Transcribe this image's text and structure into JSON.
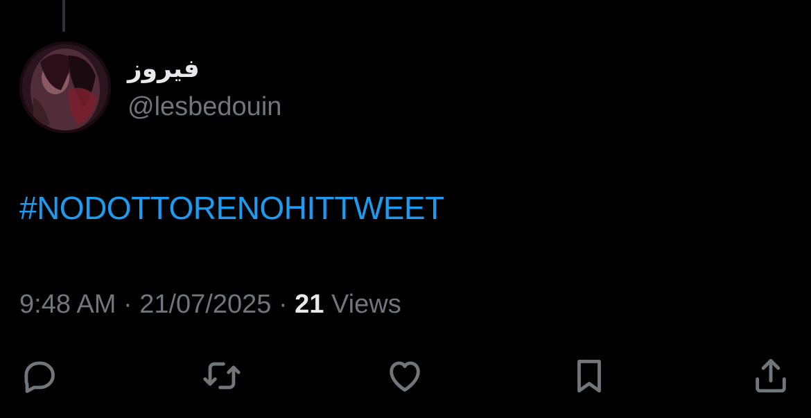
{
  "author": {
    "display_name": "فيروز",
    "handle": "@lesbedouin"
  },
  "tweet": {
    "text": "#NODOTTORENOHITTWEET"
  },
  "meta": {
    "time": "9:48 AM",
    "separator": " · ",
    "date": "21/07/2025",
    "views_count": "21",
    "views_label": "Views"
  },
  "actions": {
    "reply_icon": "reply-icon",
    "retweet_icon": "retweet-icon",
    "like_icon": "heart-icon",
    "bookmark_icon": "bookmark-icon",
    "share_icon": "share-icon"
  },
  "colors": {
    "background": "#000000",
    "hashtag": "#1d9bf0",
    "secondary_text": "#71767b",
    "primary_text": "#e7e9ea"
  }
}
